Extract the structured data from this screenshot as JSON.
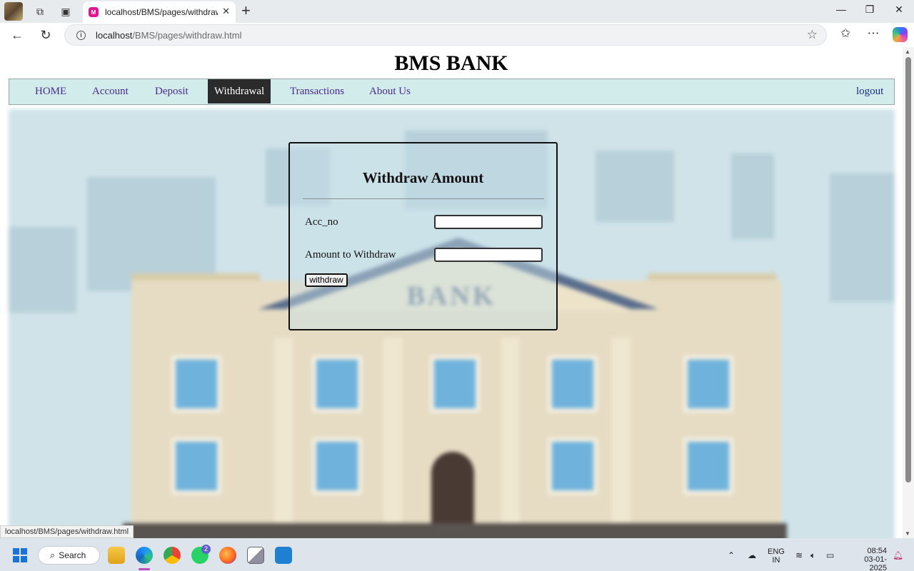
{
  "browser": {
    "tab_title": "localhost/BMS/pages/withdraw.ht",
    "url_host": "localhost",
    "url_path": "/BMS/pages/withdraw.html",
    "status_url": "localhost/BMS/pages/withdraw.html"
  },
  "site": {
    "title": "BMS BANK",
    "nav": [
      {
        "label": "HOME"
      },
      {
        "label": "Account"
      },
      {
        "label": "Deposit"
      },
      {
        "label": "Withdrawal",
        "active": true
      },
      {
        "label": "Transactions"
      },
      {
        "label": "About Us"
      }
    ],
    "logout_label": "logout",
    "background_sign": "BANK"
  },
  "form": {
    "title": "Withdraw Amount",
    "acc_label": "Acc_no",
    "acc_value": "",
    "amount_label": "Amount to Withdraw",
    "amount_value": "",
    "submit_label": "withdraw"
  },
  "taskbar": {
    "search_label": "Search",
    "whatsapp_badge": "2",
    "lang_top": "ENG",
    "lang_bottom": "IN",
    "time": "08:54",
    "date": "03-01-2025"
  },
  "colors": {
    "nav_bg": "#d2ecec",
    "nav_active_bg": "#2b2b2b",
    "nav_link": "#4a2a8a"
  }
}
